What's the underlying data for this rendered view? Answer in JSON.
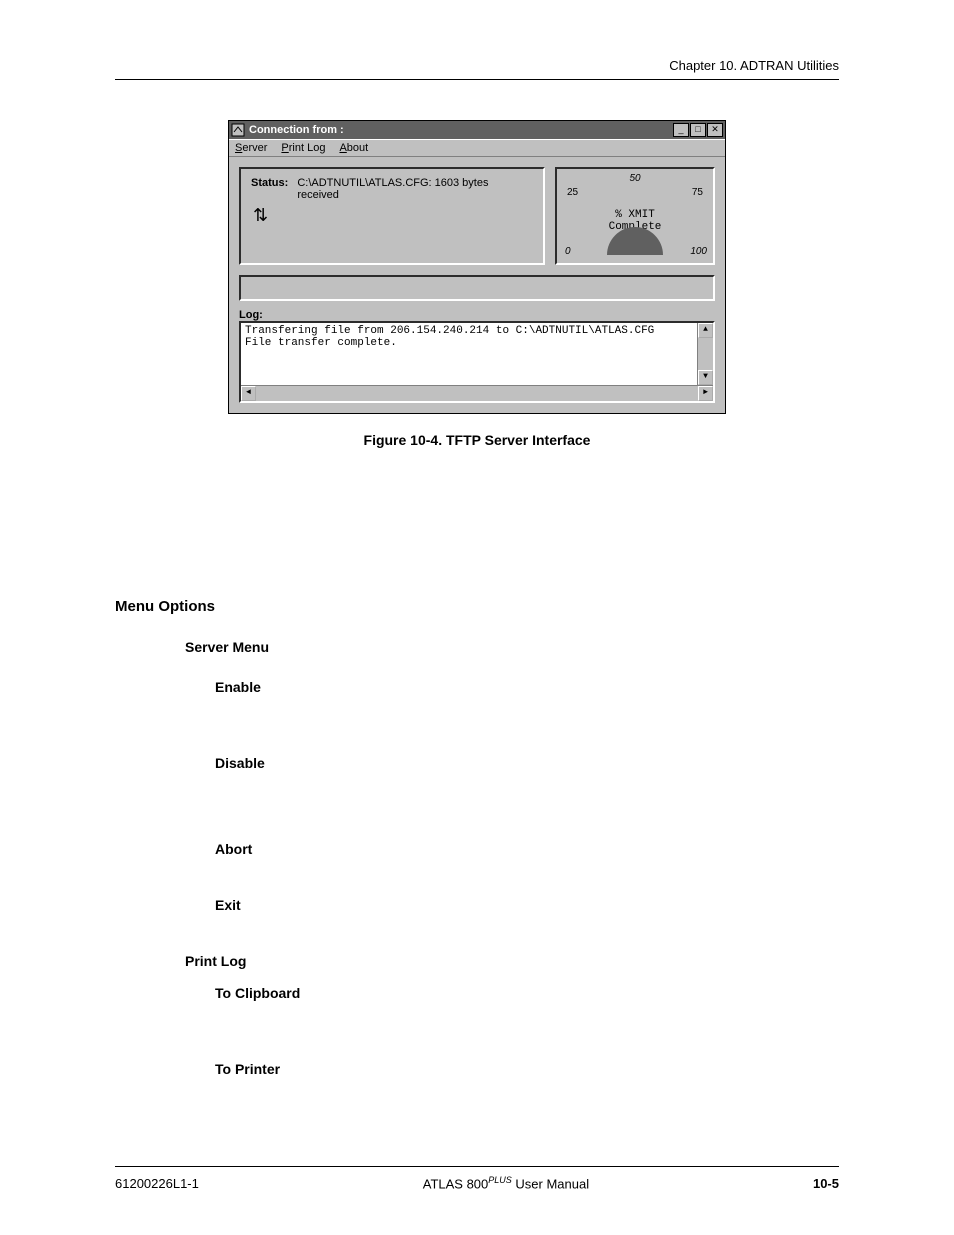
{
  "header": {
    "chapter": "Chapter 10.  ADTRAN Utilities"
  },
  "window": {
    "title": "Connection from :",
    "menus": {
      "server": "Server",
      "printlog": "Print Log",
      "about": "About"
    },
    "status": {
      "label": "Status:",
      "text": "C:\\ADTNUTIL\\ATLAS.CFG: 1603 bytes received"
    },
    "gauge": {
      "t50": "50",
      "t25": "25",
      "t75": "75",
      "t0": "0",
      "t100": "100",
      "label1": "% XMIT",
      "label2": "Complete"
    },
    "log": {
      "label": "Log:",
      "line1": "Transfering file from 206.154.240.214 to C:\\ADTNUTIL\\ATLAS.CFG",
      "line2": "File transfer complete."
    }
  },
  "caption": "Figure 10-4.  TFTP Server Interface",
  "body": {
    "menuOptions": "Menu Options",
    "serverMenu": "Server Menu",
    "enable": "Enable",
    "disable": "Disable",
    "abort": "Abort",
    "exit": "Exit",
    "printLog": "Print Log",
    "toClipboard": "To Clipboard",
    "toPrinter": "To Printer"
  },
  "footer": {
    "left": "61200226L1-1",
    "centerA": "ATLAS  800",
    "centerSup": "PLUS",
    "centerB": " User Manual",
    "right": "10-5"
  }
}
